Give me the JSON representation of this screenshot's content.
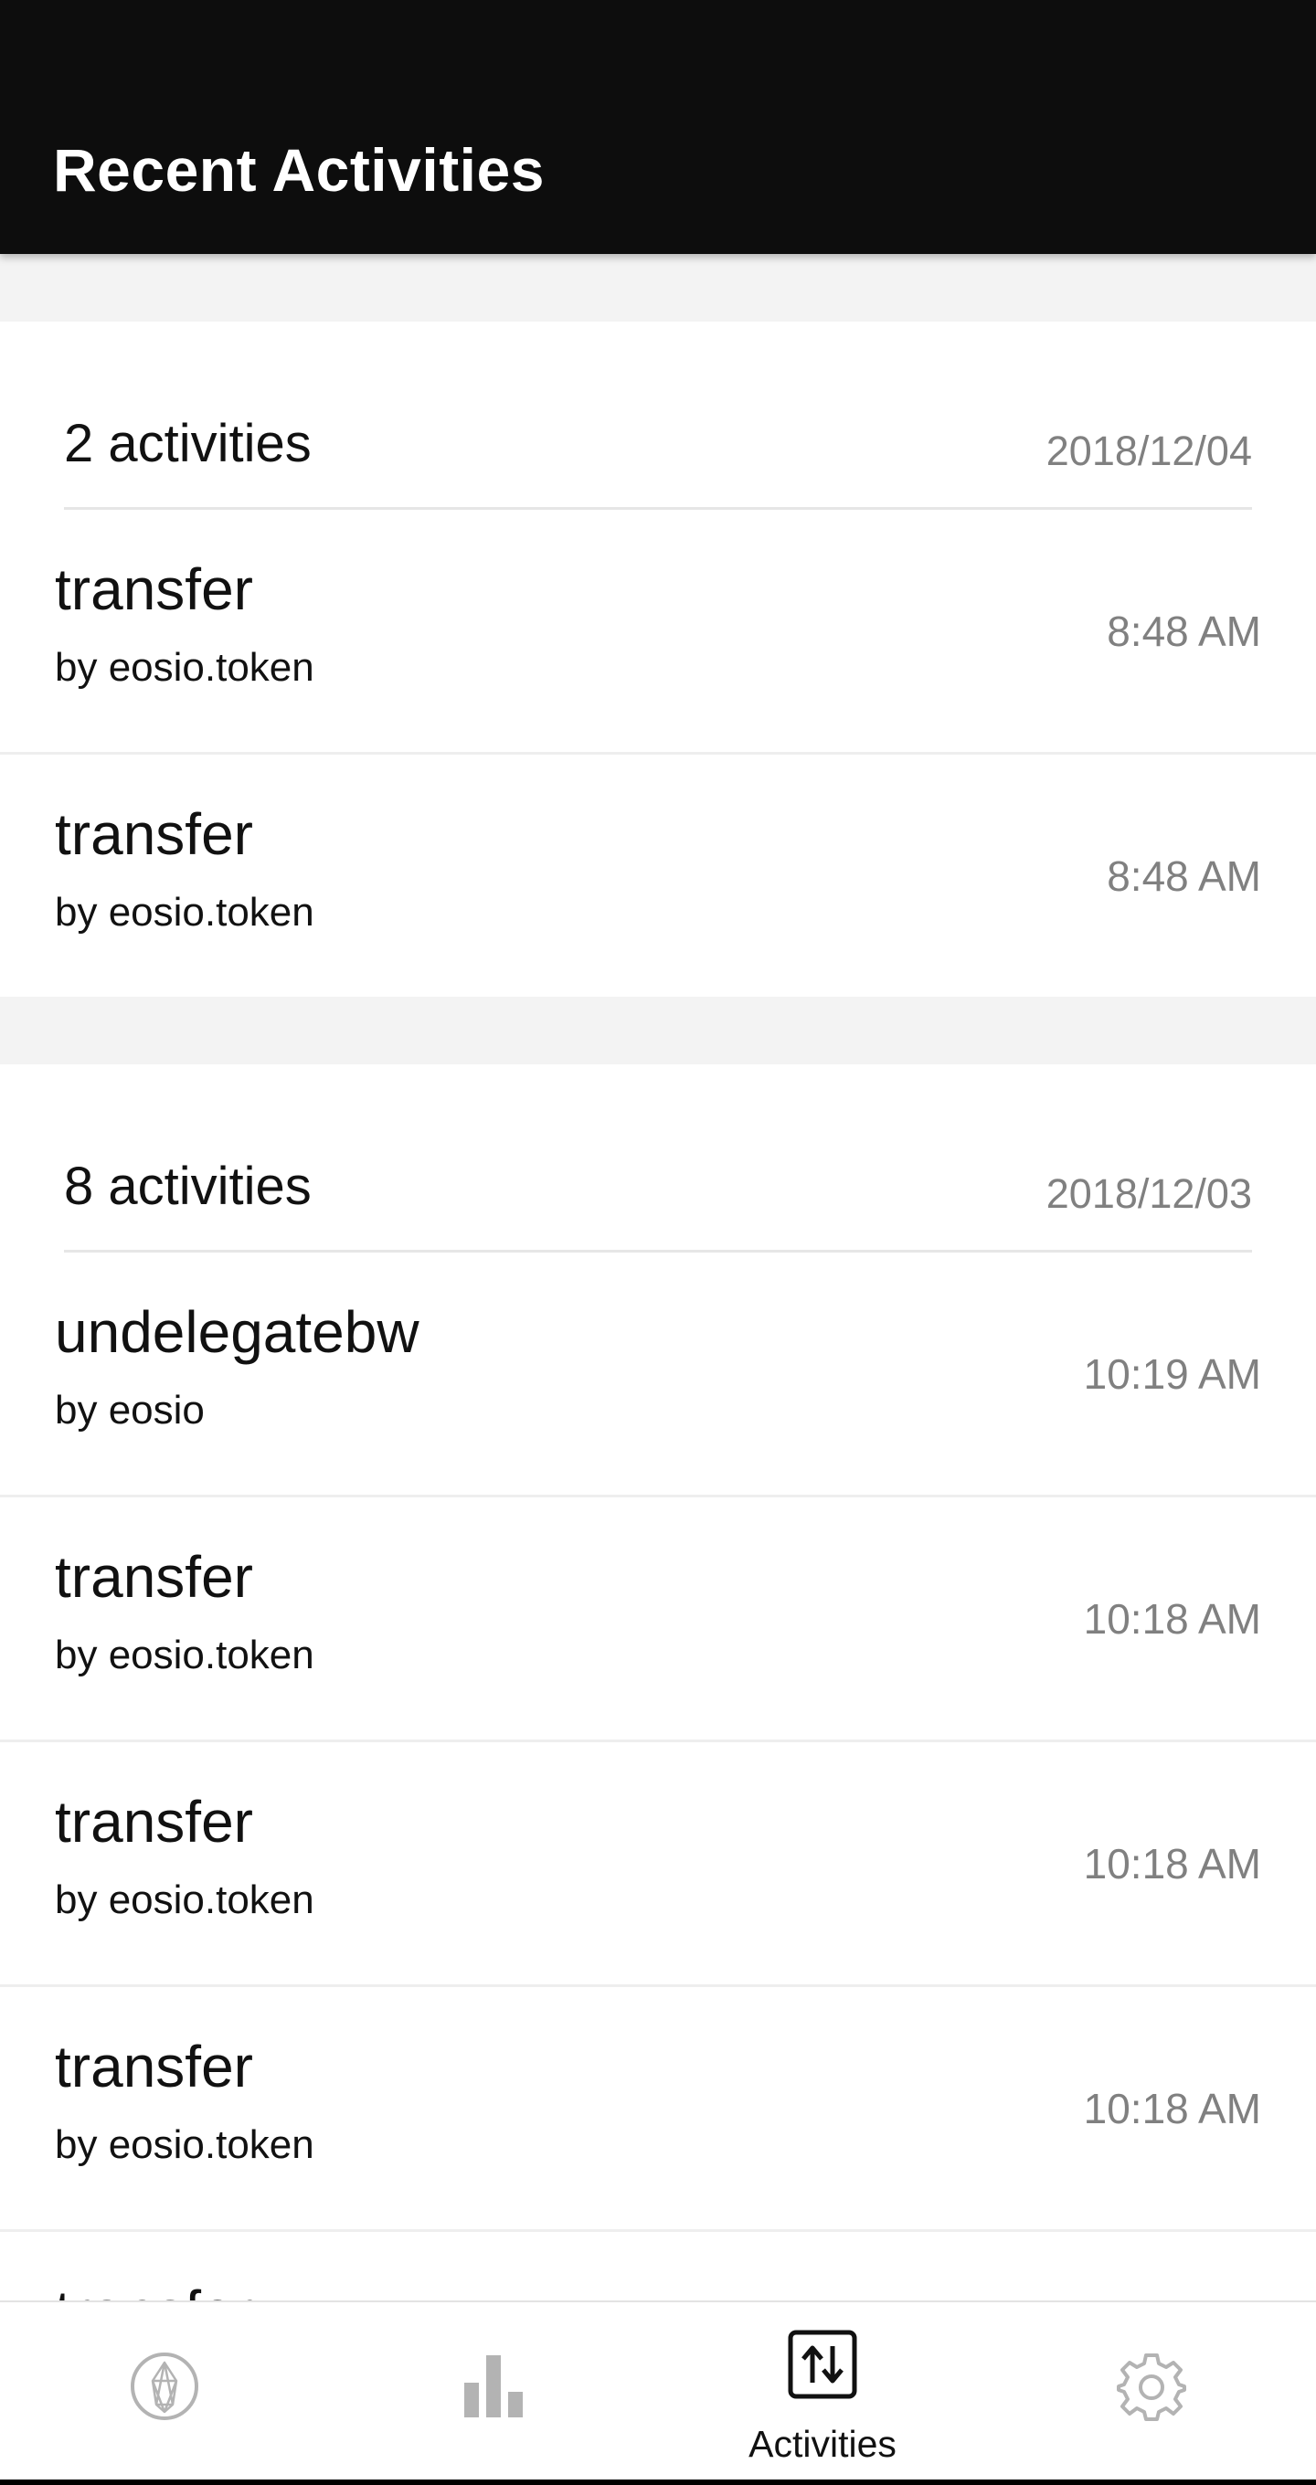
{
  "app": {
    "title": "Recent Activities"
  },
  "groups": [
    {
      "count": "2 activities",
      "date": "2018/12/04",
      "items": [
        {
          "name": "transfer",
          "by": "by eosio.token",
          "time": "8:48 AM"
        },
        {
          "name": "transfer",
          "by": "by eosio.token",
          "time": "8:48 AM"
        }
      ]
    },
    {
      "count": "8 activities",
      "date": "2018/12/03",
      "items": [
        {
          "name": "undelegatebw",
          "by": "by eosio",
          "time": "10:19 AM"
        },
        {
          "name": "transfer",
          "by": "by eosio.token",
          "time": "10:18 AM"
        },
        {
          "name": "transfer",
          "by": "by eosio.token",
          "time": "10:18 AM"
        },
        {
          "name": "transfer",
          "by": "by eosio.token",
          "time": "10:18 AM"
        },
        {
          "name": "transfer",
          "by": "",
          "time": ""
        }
      ]
    }
  ],
  "nav": {
    "items": [
      {
        "icon": "eos-logo-icon",
        "label": ""
      },
      {
        "icon": "bar-chart-icon",
        "label": ""
      },
      {
        "icon": "transfer-arrows-icon",
        "label": "Activities"
      },
      {
        "icon": "gear-icon",
        "label": ""
      }
    ],
    "active_color": "#111111",
    "inactive_color": "#b3b3b3"
  }
}
